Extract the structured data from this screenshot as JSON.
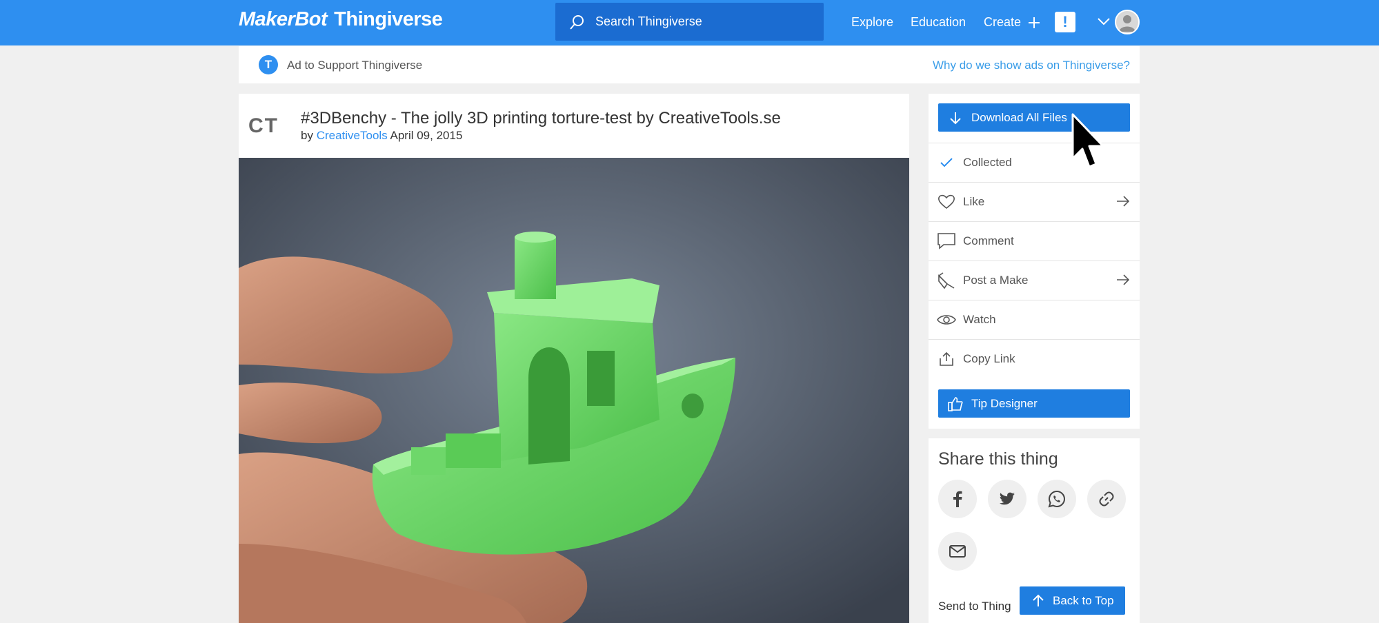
{
  "header": {
    "logo_maker": "MakerBot",
    "logo_thing": "Thingiverse",
    "search_placeholder": "Search Thingiverse",
    "nav": {
      "explore": "Explore",
      "education": "Education",
      "create": "Create"
    },
    "alert": "!"
  },
  "ad": {
    "badge": "T",
    "text": "Ad to Support Thingiverse",
    "why_link": "Why do we show ads on Thingiverse?"
  },
  "thing": {
    "creator_logo": "CT",
    "title": "#3DBenchy - The jolly 3D printing torture-test by CreativeTools.se",
    "by": "by",
    "author": "CreativeTools",
    "date": "April 09, 2015"
  },
  "actions": {
    "download": "Download All Files",
    "collected": "Collected",
    "like": "Like",
    "comment": "Comment",
    "post_make": "Post a Make",
    "watch": "Watch",
    "copy_link": "Copy Link",
    "tip": "Tip Designer"
  },
  "share": {
    "title": "Share this thing",
    "send_label": "Send to Thing",
    "back_to_top": "Back to Top"
  },
  "colors": {
    "brand_blue": "#2e8ff0",
    "button_blue": "#1f7ee0",
    "search_bg": "#1b6cd1",
    "benchy_green": "#6fd66a"
  }
}
